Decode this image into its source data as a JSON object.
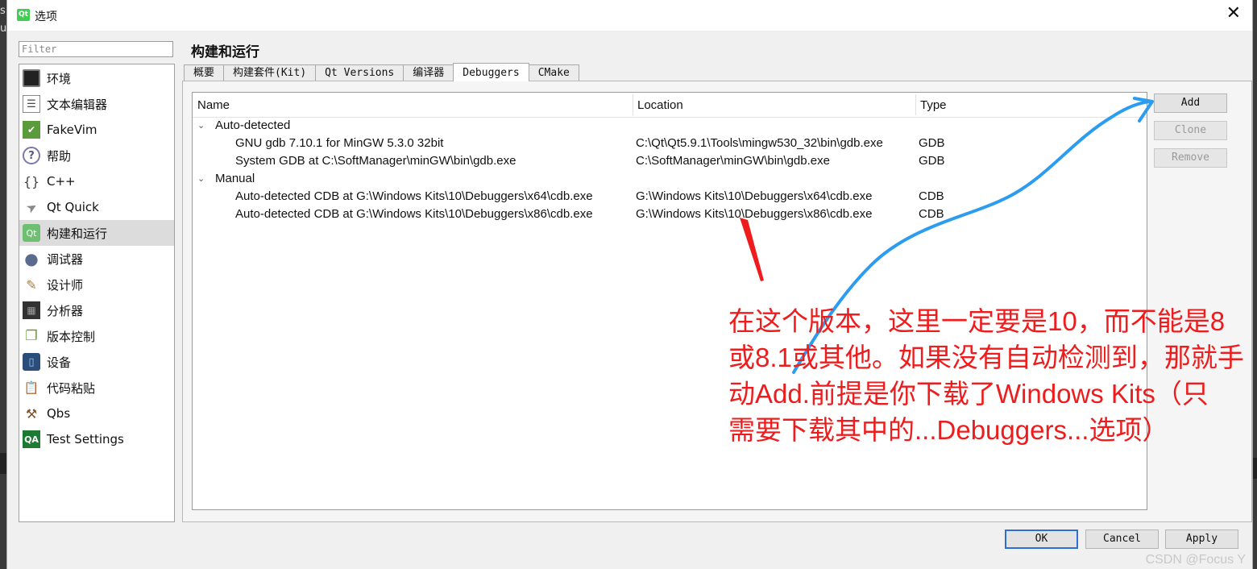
{
  "window": {
    "title": "选项",
    "close_glyph": "✕",
    "logo_text": "Qt"
  },
  "filter": {
    "placeholder": "Filter"
  },
  "sidebar": {
    "items": [
      {
        "label": "环境",
        "icon": "monitor-icon",
        "selected": false
      },
      {
        "label": "文本编辑器",
        "icon": "text-editor-icon",
        "selected": false
      },
      {
        "label": "FakeVim",
        "icon": "fakevim-icon",
        "selected": false
      },
      {
        "label": "帮助",
        "icon": "help-icon",
        "selected": false
      },
      {
        "label": "C++",
        "icon": "braces-icon",
        "selected": false
      },
      {
        "label": "Qt Quick",
        "icon": "paper-plane-icon",
        "selected": false
      },
      {
        "label": "构建和运行",
        "icon": "build-run-icon",
        "selected": true
      },
      {
        "label": "调试器",
        "icon": "debugger-bug-icon",
        "selected": false
      },
      {
        "label": "设计师",
        "icon": "designer-icon",
        "selected": false
      },
      {
        "label": "分析器",
        "icon": "analyzer-icon",
        "selected": false
      },
      {
        "label": "版本控制",
        "icon": "version-control-icon",
        "selected": false
      },
      {
        "label": "设备",
        "icon": "device-icon",
        "selected": false
      },
      {
        "label": "代码粘贴",
        "icon": "code-paste-icon",
        "selected": false
      },
      {
        "label": "Qbs",
        "icon": "hammer-icon",
        "selected": false
      },
      {
        "label": "Test Settings",
        "icon": "qa-icon",
        "selected": false
      }
    ]
  },
  "page_title": "构建和运行",
  "tabs": [
    {
      "label": "概要",
      "active": false
    },
    {
      "label": "构建套件(Kit)",
      "active": false
    },
    {
      "label": "Qt Versions",
      "active": false
    },
    {
      "label": "编译器",
      "active": false
    },
    {
      "label": "Debuggers",
      "active": true
    },
    {
      "label": "CMake",
      "active": false
    }
  ],
  "debuggers": {
    "columns": [
      "Name",
      "Location",
      "Type"
    ],
    "groups": [
      {
        "label": "Auto-detected",
        "rows": [
          {
            "name": "GNU gdb 7.10.1 for MinGW 5.3.0 32bit",
            "location": "C:\\Qt\\Qt5.9.1\\Tools\\mingw530_32\\bin\\gdb.exe",
            "type": "GDB"
          },
          {
            "name": "System GDB at C:\\SoftManager\\minGW\\bin\\gdb.exe",
            "location": "C:\\SoftManager\\minGW\\bin\\gdb.exe",
            "type": "GDB"
          }
        ]
      },
      {
        "label": "Manual",
        "rows": [
          {
            "name": "Auto-detected CDB at G:\\Windows Kits\\10\\Debuggers\\x64\\cdb.exe",
            "location": "G:\\Windows Kits\\10\\Debuggers\\x64\\cdb.exe",
            "type": "CDB"
          },
          {
            "name": "Auto-detected CDB at G:\\Windows Kits\\10\\Debuggers\\x86\\cdb.exe",
            "location": "G:\\Windows Kits\\10\\Debuggers\\x86\\cdb.exe",
            "type": "CDB"
          }
        ]
      }
    ]
  },
  "side_buttons": {
    "add": "Add",
    "clone": "Clone",
    "remove": "Remove"
  },
  "dialog_buttons": {
    "ok": "OK",
    "cancel": "Cancel",
    "apply": "Apply"
  },
  "annotation": {
    "lines": [
      "在这个版本，这里一定要是10，而不能是8",
      "或8.1或其他。如果没有自动检测到，那就手",
      "动Add.前提是你下载了Windows Kits（只",
      "需要下载其中的...Debuggers...选项）"
    ],
    "color": "#ee1c1c"
  },
  "arrow_colors": {
    "red": "#ee1c1c",
    "blue": "#2b9cf0"
  },
  "watermark": "CSDN @Focus Y",
  "edge_text": {
    "top": "s",
    "second": "u"
  },
  "colors": {
    "selected_bg": "#dcdcdc",
    "default_button_border": "#2e6fd2"
  }
}
